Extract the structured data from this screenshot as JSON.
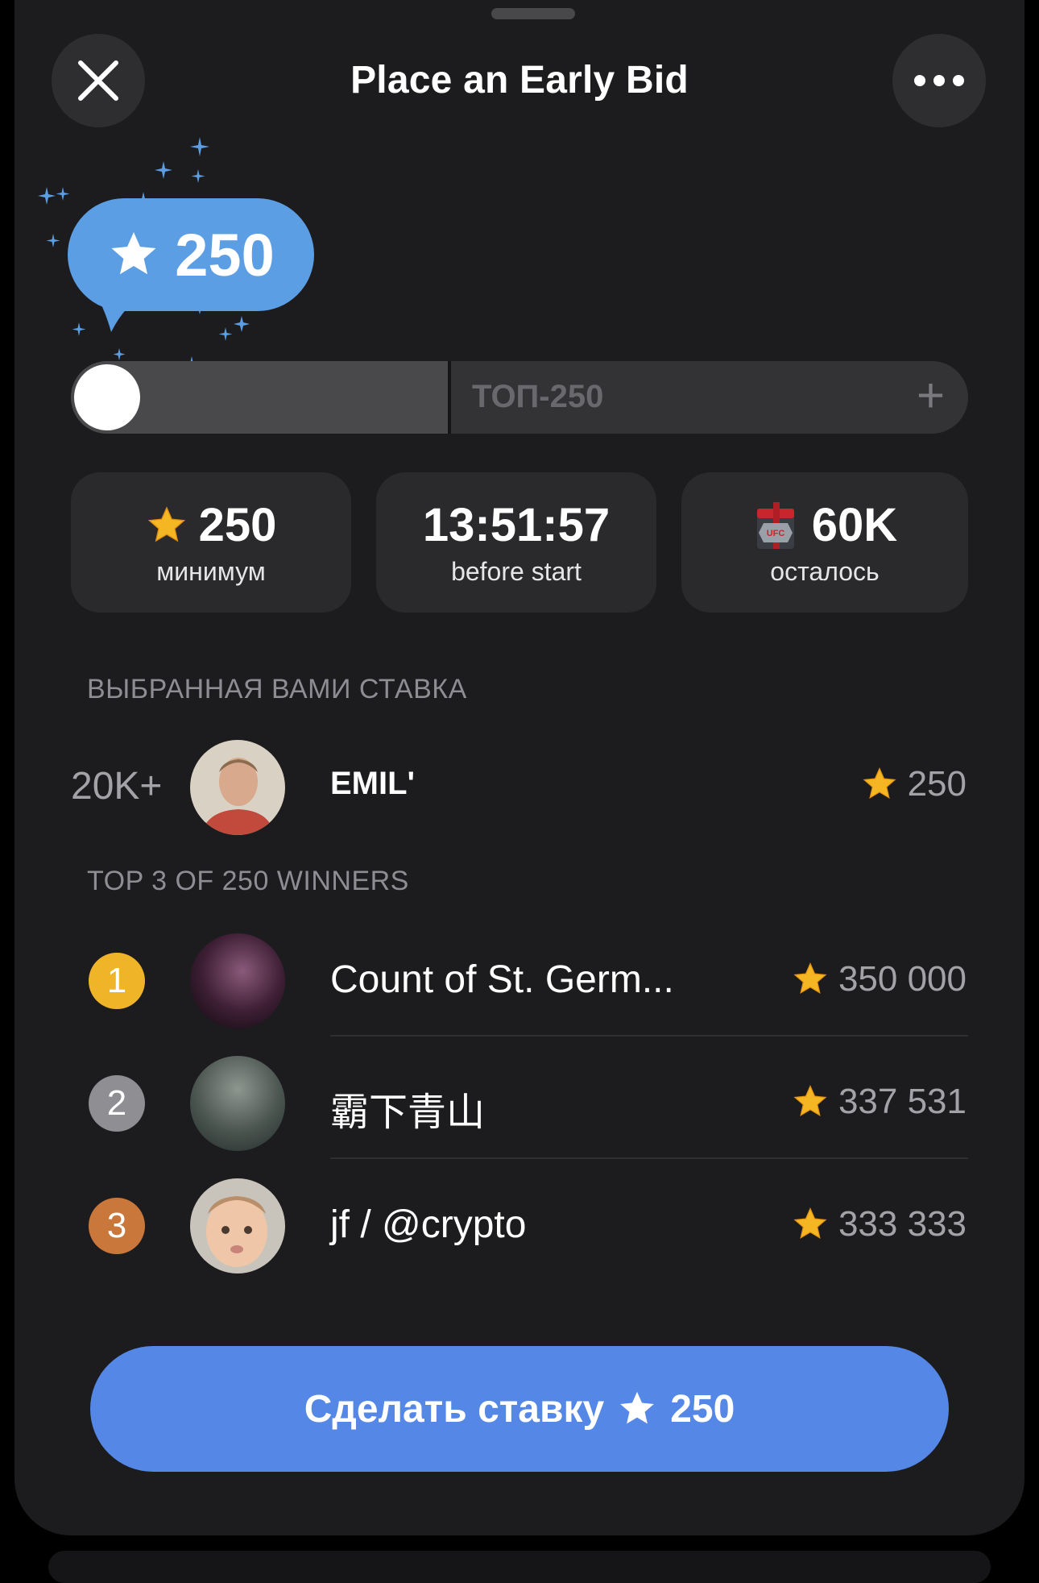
{
  "header": {
    "title": "Place an Early Bid"
  },
  "bid": {
    "value": "250"
  },
  "slider": {
    "label": "ТОП-250",
    "position": 0.0,
    "divider": 0.42
  },
  "stats": [
    {
      "value": "250",
      "label": "минимум",
      "icon": "gold-star-icon"
    },
    {
      "value": "13:51:57",
      "label": "before start"
    },
    {
      "value": "60K",
      "label": "осталось",
      "icon": "ufc-gift-box-icon"
    }
  ],
  "your_bid": {
    "header": "ВЫБРАННАЯ ВАМИ СТАВКА",
    "rank": "20K+",
    "name": "EMILʹ",
    "amount": "250"
  },
  "winners": {
    "header": "TOP 3 OF 250 WINNERS",
    "rows": [
      {
        "rank": "1",
        "name": "Count of St. Germ...",
        "amount": "350 000",
        "medal_color": "#f0b429"
      },
      {
        "rank": "2",
        "name": "霸下青山",
        "amount": "337 531",
        "medal_color": "#8e8e93"
      },
      {
        "rank": "3",
        "name": "jf / @crypto",
        "amount": "333 333",
        "medal_color": "#c9773a"
      }
    ]
  },
  "cta": {
    "label": "Сделать ставку",
    "amount": "250"
  },
  "colors": {
    "accent": "#5487e6",
    "bubble": "#5c9ee4",
    "star": "#f5b623"
  }
}
